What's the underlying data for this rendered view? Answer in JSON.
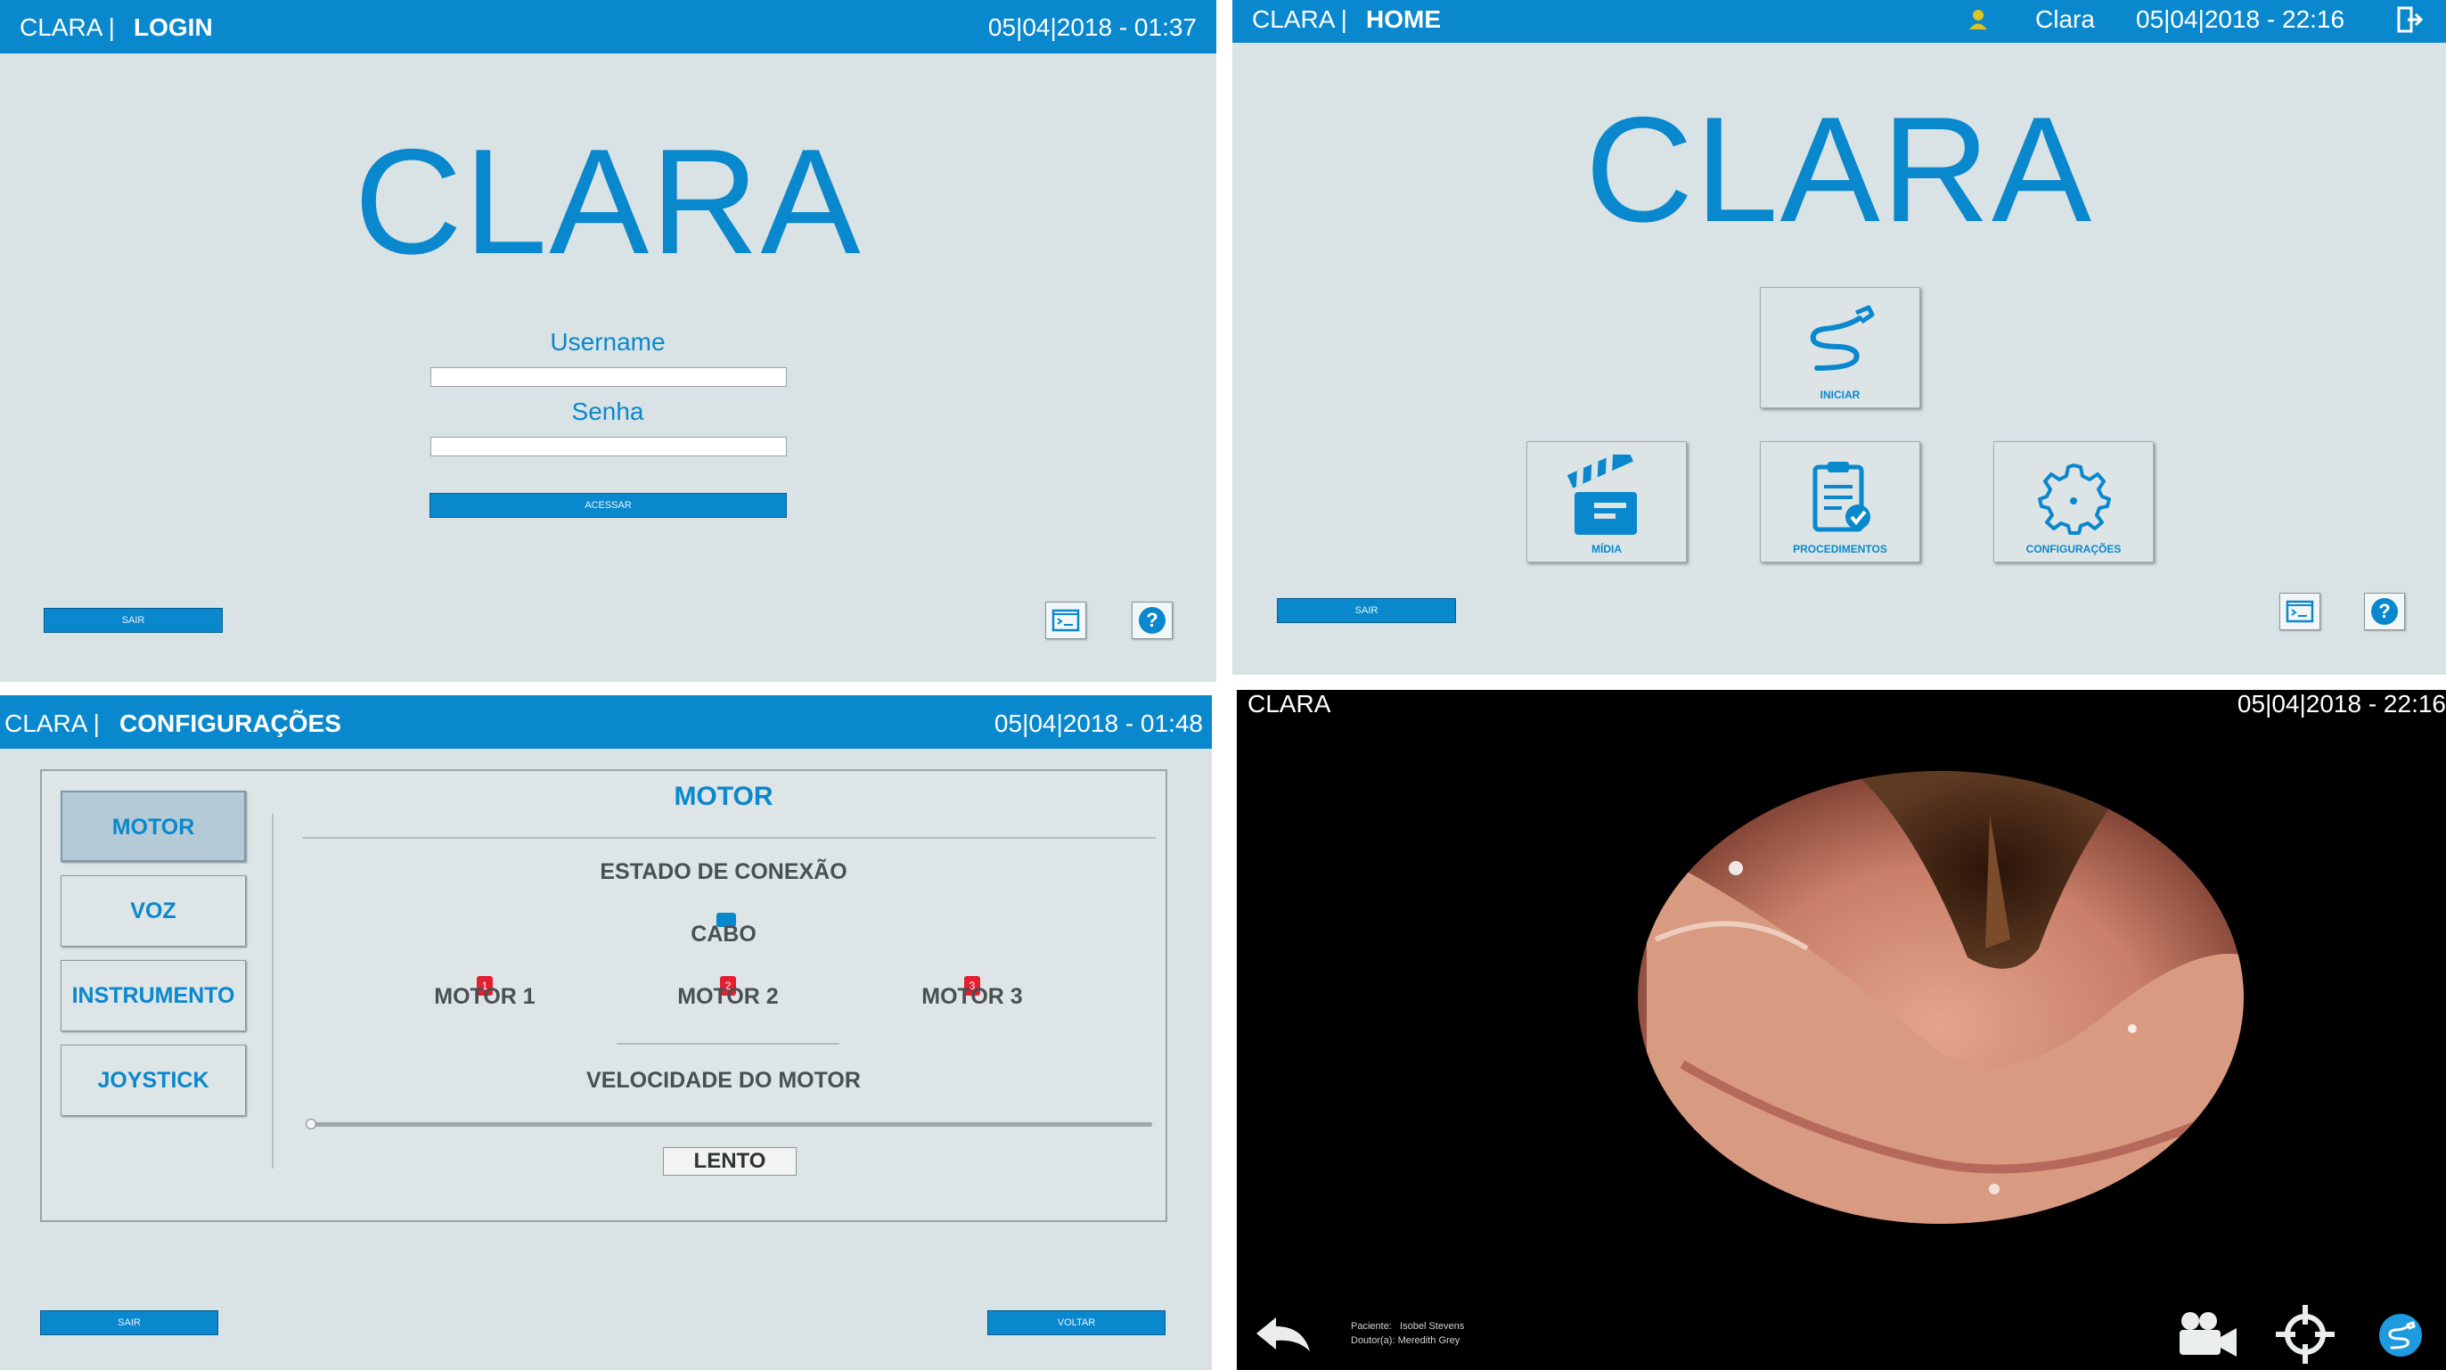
{
  "login": {
    "app": "CLARA |",
    "page": "LOGIN",
    "datetime": "05|04|2018 - 01:37",
    "logo": "CLARA",
    "username_label": "Username",
    "password_label": "Senha",
    "submit": "ACESSAR",
    "exit": "SAIR",
    "icons": [
      "terminal-icon",
      "help-icon"
    ]
  },
  "home": {
    "app": "CLARA |",
    "page": "HOME",
    "user": "Clara",
    "datetime": "05|04|2018 - 22:16",
    "logo": "CLARA",
    "tiles": {
      "start": "INICIAR",
      "media": "MÍDIA",
      "procedures": "PROCEDIMENTOS",
      "settings": "CONFIGURAÇÕES"
    },
    "exit": "SAIR",
    "icons": [
      "user-icon",
      "logout-icon",
      "terminal-icon",
      "help-icon"
    ]
  },
  "config": {
    "app": "CLARA |",
    "page": "CONFIGURAÇÕES",
    "datetime": "05|04|2018 - 01:48",
    "menu": [
      "MOTOR",
      "VOZ",
      "INSTRUMENTO",
      "JOYSTICK"
    ],
    "active_menu": "MOTOR",
    "section_title": "MOTOR",
    "connection_title": "ESTADO DE CONEXÃO",
    "cable": "CABO",
    "motors": [
      {
        "num": "1",
        "label": "MOTOR 1"
      },
      {
        "num": "2",
        "label": "MOTOR 2"
      },
      {
        "num": "3",
        "label": "MOTOR 3"
      }
    ],
    "speed_title": "VELOCIDADE DO MOTOR",
    "speed_value": "LENTO",
    "speed_level": 0,
    "exit": "SAIR",
    "back": "VOLTAR",
    "colors": {
      "motor_status": "#e32030",
      "cable_status": "#0a88cd"
    }
  },
  "video": {
    "app": "CLARA",
    "datetime": "05|04|2018 - 22:16",
    "patient_label": "Paciente:",
    "patient_name": "Isobel Stevens",
    "doctor_label": "Doutor(a):",
    "doctor_name": "Meredith Grey",
    "icons": [
      "back-arrow-icon",
      "video-camera-icon",
      "crosshair-icon",
      "endoscope-icon"
    ]
  },
  "colors": {
    "accent": "#0a88cd",
    "panel_bg": "#d9e2e4"
  }
}
